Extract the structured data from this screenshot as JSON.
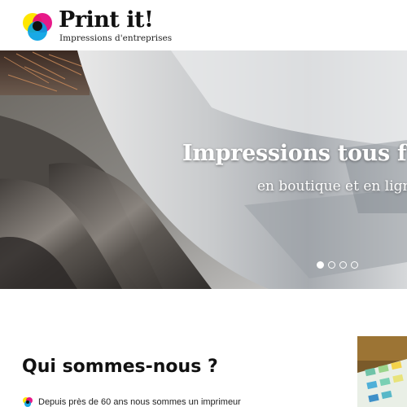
{
  "brand": {
    "name": "Print it!",
    "tagline": "Impressions d'entreprises",
    "logo_icon": "cmyk-circles-logo-icon"
  },
  "hero": {
    "title": "Impressions tous f",
    "subtitle": "en boutique et en lign",
    "carousel": {
      "slides": 4,
      "active_index": 0
    }
  },
  "about": {
    "title": "Qui sommes-nous ?",
    "intro": "Depuis près de 60 ans nous sommes un imprimeur",
    "bullet_icon": "cmyk-circles-icon"
  },
  "colors": {
    "cyan": "#00a0e3",
    "magenta": "#e4007c",
    "yellow": "#ffe600",
    "black": "#111111"
  }
}
